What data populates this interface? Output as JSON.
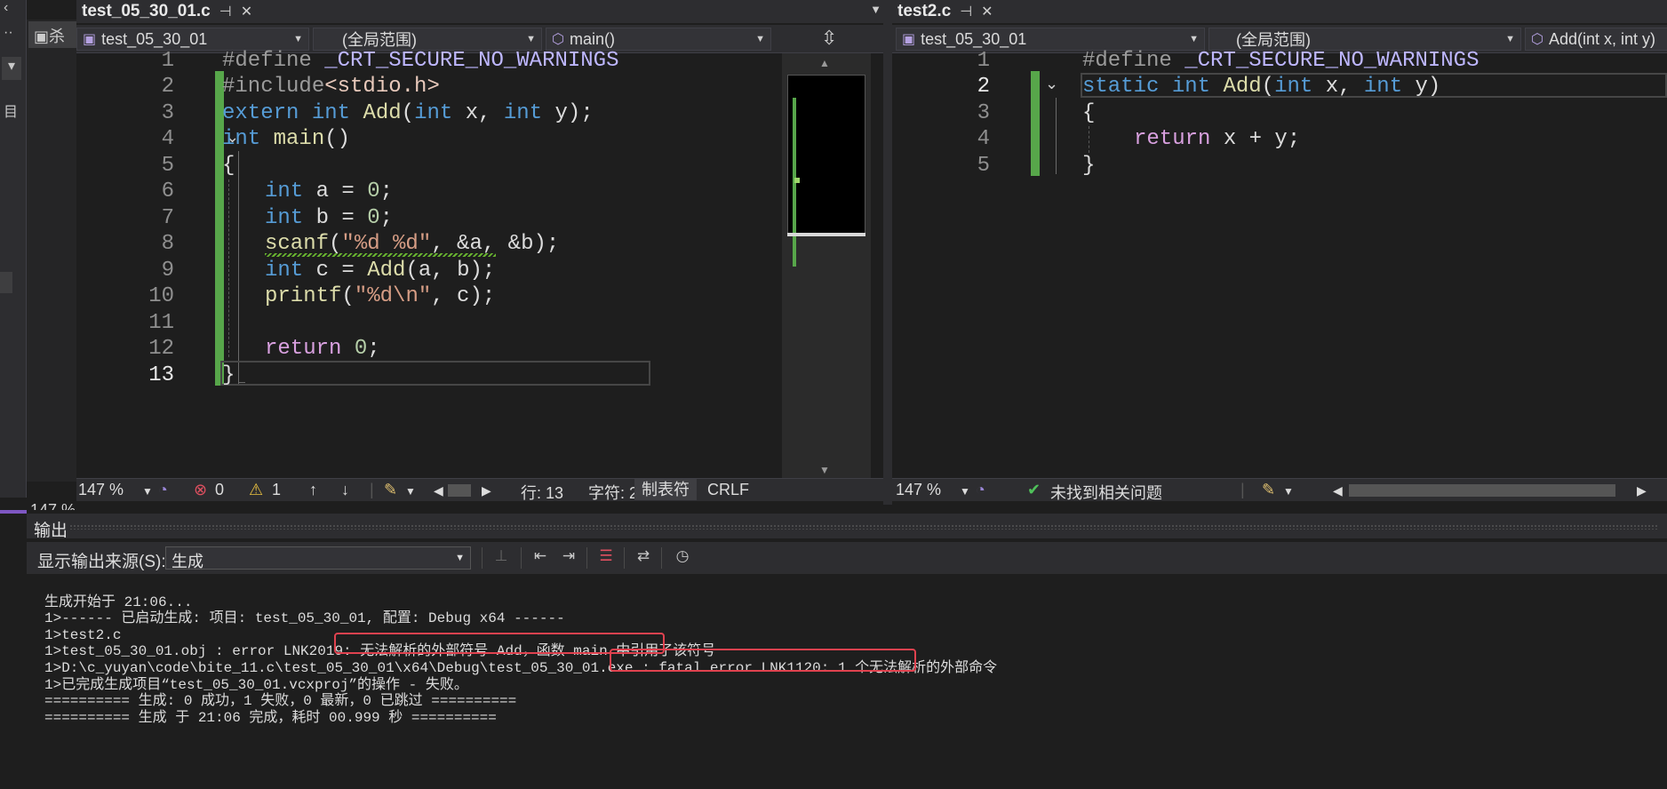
{
  "left_strip": {
    "tab_fragment": "杀",
    "zoom_fragment": "147 %",
    "side_char": "目"
  },
  "left_pane": {
    "tab_name": "test_05_30_01.c",
    "nav": {
      "project": "test_05_30_01",
      "scope": "(全局范围)",
      "member": "main()"
    },
    "lines": [
      {
        "n": "1"
      },
      {
        "n": "2"
      },
      {
        "n": "3"
      },
      {
        "n": "4"
      },
      {
        "n": "5"
      },
      {
        "n": "6"
      },
      {
        "n": "7"
      },
      {
        "n": "8"
      },
      {
        "n": "9"
      },
      {
        "n": "10"
      },
      {
        "n": "11"
      },
      {
        "n": "12"
      },
      {
        "n": "13"
      }
    ],
    "code": {
      "l1_pp": "#define",
      "l1_mac": "_CRT_SECURE_NO_WARNINGS",
      "l2_pp": "#include",
      "l2_inc": "<stdio.h>",
      "l3_a": "extern",
      "l3_b": "int",
      "l3_fn": "Add",
      "l3_c": "(",
      "l3_d": "int",
      "l3_e": " x, ",
      "l3_f": "int",
      "l3_g": " y);",
      "l4_kw": "int",
      "l4_fn": "main",
      "l4_rest": "()",
      "l5": "{",
      "l6_kw": "int",
      "l6_rest": " a = ",
      "l6_num": "0",
      "l6_end": ";",
      "l7_kw": "int",
      "l7_rest": " b = ",
      "l7_num": "0",
      "l7_end": ";",
      "l8_fn": "scanf",
      "l8_a": "(",
      "l8_str": "\"%d %d\"",
      "l8_b": ", &a, &b);",
      "l9_kw": "int",
      "l9_a": " c = ",
      "l9_fn": "Add",
      "l9_b": "(a, b);",
      "l10_fn": "printf",
      "l10_a": "(",
      "l10_str": "\"%d\\n\"",
      "l10_b": ", c);",
      "l12_ctl": "return",
      "l12_sp": " ",
      "l12_num": "0",
      "l12_end": ";",
      "l13": "}"
    },
    "status": {
      "zoom": "147 %",
      "errors": "0",
      "warnings": "1",
      "line": "行: 13",
      "char": "字符: 2",
      "tab": "制表符",
      "eol": "CRLF"
    }
  },
  "right_pane": {
    "tab_name": "test2.c",
    "nav": {
      "project": "test_05_30_01",
      "scope": "(全局范围)",
      "member": "Add(int x, int y)"
    },
    "lines": [
      {
        "n": "1"
      },
      {
        "n": "2"
      },
      {
        "n": "3"
      },
      {
        "n": "4"
      },
      {
        "n": "5"
      }
    ],
    "code": {
      "l1_pp": "#define",
      "l1_mac": "_CRT_SECURE_NO_WARNINGS",
      "l2_a": "static",
      "l2_b": "int",
      "l2_fn": "Add",
      "l2_c": "(",
      "l2_d": "int",
      "l2_e": " x, ",
      "l2_f": "int",
      "l2_g": " y)",
      "l3": "{",
      "l4_ctl": "return",
      "l4_rest": " x + y;",
      "l5": "}"
    },
    "status": {
      "zoom": "147 %",
      "issues": "未找到相关问题"
    }
  },
  "output": {
    "title": "输出",
    "source_label": "显示输出来源(S):",
    "source_value": "生成",
    "lines": [
      "生成开始于 21:06...",
      "1>------ 已启动生成: 项目: test_05_30_01, 配置: Debug x64 ------",
      "1>test2.c",
      "1>test_05_30_01.obj : error LNK2019: 无法解析的外部符号 Add，函数 main 中引用了该符号",
      "1>D:\\c_yuyan\\code\\bite_11.c\\test_05_30_01\\x64\\Debug\\test_05_30_01.exe : fatal error LNK1120: 1 个无法解析的外部命令",
      "1>已完成生成项目“test_05_30_01.vcxproj”的操作 - 失败。",
      "========== 生成: 0 成功，1 失败，0 最新，0 已跳过 ==========",
      "========== 生成 于 21:06 完成，耗时 00.999 秒 =========="
    ]
  },
  "colors": {
    "accent": "#7e57c2",
    "highlight_box": "#e0424f",
    "change_bar": "#57a64a"
  }
}
